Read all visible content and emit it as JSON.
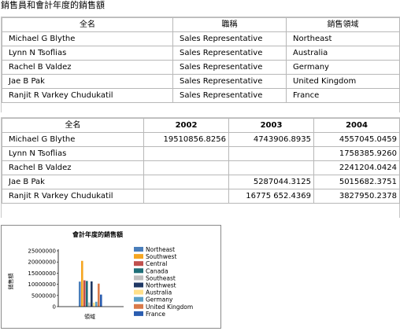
{
  "report_title": "銷售員和會計年度的銷售額",
  "table1": {
    "headers": [
      "全名",
      "職稱",
      "銷售領域"
    ],
    "rows": [
      [
        "Michael G Blythe",
        "Sales Representative",
        "Northeast"
      ],
      [
        "Lynn N Tsoflias",
        "Sales Representative",
        "Australia"
      ],
      [
        "Rachel B Valdez",
        "Sales Representative",
        "Germany"
      ],
      [
        "Jae B Pak",
        "Sales Representative",
        "United Kingdom"
      ],
      [
        "Ranjit R Varkey Chudukatil",
        "Sales Representative",
        "France"
      ]
    ]
  },
  "table2": {
    "headers": [
      "全名",
      "2002",
      "2003",
      "2004"
    ],
    "rows": [
      [
        "Michael G Blythe",
        "19510856.8256",
        "4743906.8935",
        "4557045.0459"
      ],
      [
        "Lynn N Tsoflias",
        "",
        "",
        "1758385.9260"
      ],
      [
        "Rachel B Valdez",
        "",
        "",
        "2241204.0424"
      ],
      [
        "Jae B Pak",
        "",
        "5287044.3125",
        "5015682.3751"
      ],
      [
        "Ranjit R Varkey Chudukatil",
        "",
        "16775 652.4369",
        "3827950.2378"
      ]
    ]
  },
  "chart_data": {
    "type": "bar",
    "title": "會計年度的銷售額",
    "xlabel": "領域",
    "ylabel": "銷售額",
    "ylim": [
      0,
      25000000
    ],
    "yticks": [
      "0",
      "5000000",
      "10000000",
      "15000000",
      "20000000",
      "25000000"
    ],
    "legend_position": "right",
    "series": [
      {
        "name": "Northeast",
        "color": "#4a7ebb",
        "value": 11200000
      },
      {
        "name": "Southwest",
        "color": "#f5a623",
        "value": 20500000
      },
      {
        "name": "Central",
        "color": "#c0504d",
        "value": 11800000
      },
      {
        "name": "Canada",
        "color": "#1f6f78",
        "value": 11500000
      },
      {
        "name": "Southeast",
        "color": "#bfbfbf",
        "value": 1900000
      },
      {
        "name": "Northwest",
        "color": "#1f3864",
        "value": 11300000
      },
      {
        "name": "Australia",
        "color": "#ffe08a",
        "value": 1800000
      },
      {
        "name": "Germany",
        "color": "#5aa0c8",
        "value": 2200000
      },
      {
        "name": "United Kingdom",
        "color": "#d97a4a",
        "value": 10300000
      },
      {
        "name": "France",
        "color": "#2a5db0",
        "value": 5400000
      }
    ]
  }
}
